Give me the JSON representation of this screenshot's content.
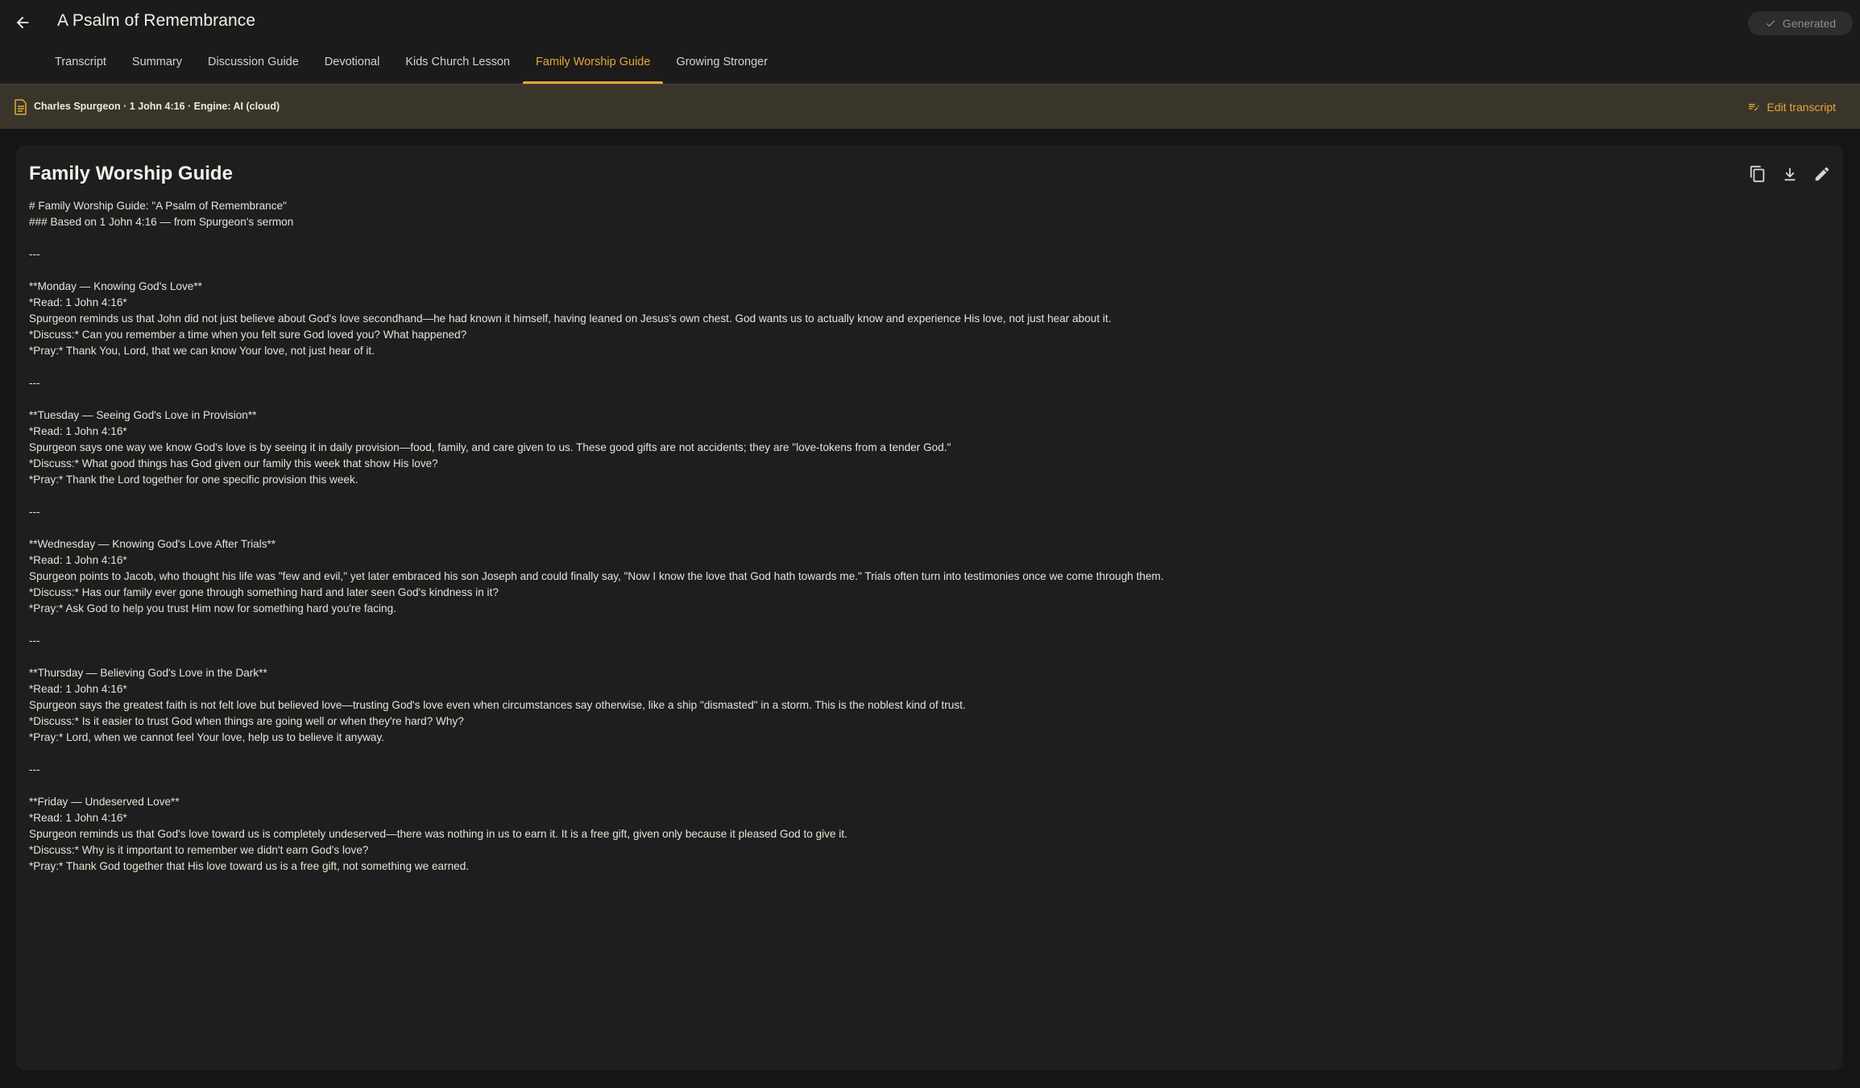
{
  "header": {
    "title": "A Psalm of Remembrance",
    "status_label": "Generated"
  },
  "tabs": [
    {
      "label": "Transcript"
    },
    {
      "label": "Summary"
    },
    {
      "label": "Discussion Guide"
    },
    {
      "label": "Devotional"
    },
    {
      "label": "Kids Church Lesson"
    },
    {
      "label": "Family Worship Guide",
      "active": true
    },
    {
      "label": "Growing Stronger"
    }
  ],
  "infobar": {
    "meta": "Charles Spurgeon · 1 John 4:16 · Engine: AI (cloud)",
    "edit_label": "Edit transcript"
  },
  "card": {
    "title": "Family Worship Guide",
    "lines": [
      "# Family Worship Guide: \"A Psalm of Remembrance\"",
      "### Based on 1 John 4:16 — from Spurgeon's sermon",
      "",
      "---",
      "",
      "**Monday — Knowing God's Love**",
      "*Read: 1 John 4:16*",
      "Spurgeon reminds us that John did not just believe about God's love secondhand—he had known it himself, having leaned on Jesus's own chest. God wants us to actually know and experience His love, not just hear about it.",
      "*Discuss:* Can you remember a time when you felt sure God loved you? What happened?",
      "*Pray:* Thank You, Lord, that we can know Your love, not just hear of it.",
      "",
      "---",
      "",
      "**Tuesday — Seeing God's Love in Provision**",
      "*Read: 1 John 4:16*",
      "Spurgeon says one way we know God's love is by seeing it in daily provision—food, family, and care given to us. These good gifts are not accidents; they are \"love-tokens from a tender God.\"",
      "*Discuss:* What good things has God given our family this week that show His love?",
      "*Pray:* Thank the Lord together for one specific provision this week.",
      "",
      "---",
      "",
      "**Wednesday — Knowing God's Love After Trials**",
      "*Read: 1 John 4:16*",
      "Spurgeon points to Jacob, who thought his life was \"few and evil,\" yet later embraced his son Joseph and could finally say, \"Now I know the love that God hath towards me.\" Trials often turn into testimonies once we come through them.",
      "*Discuss:* Has our family ever gone through something hard and later seen God's kindness in it?",
      "*Pray:* Ask God to help you trust Him now for something hard you're facing.",
      "",
      "---",
      "",
      "**Thursday — Believing God's Love in the Dark**",
      "*Read: 1 John 4:16*",
      "Spurgeon says the greatest faith is not felt love but believed love—trusting God's love even when circumstances say otherwise, like a ship \"dismasted\" in a storm. This is the noblest kind of trust.",
      "*Discuss:* Is it easier to trust God when things are going well or when they're hard? Why?",
      "*Pray:* Lord, when we cannot feel Your love, help us to believe it anyway.",
      "",
      "---",
      "",
      "**Friday — Undeserved Love**",
      "*Read: 1 John 4:16*",
      "Spurgeon reminds us that God's love toward us is completely undeserved—there was nothing in us to earn it. It is a free gift, given only because it pleased God to give it.",
      "*Discuss:* Why is it important to remember we didn't earn God's love?",
      "*Pray:* Thank God together that His love toward us is a free gift, not something we earned."
    ]
  },
  "icons": {
    "back": "arrow-back-icon",
    "status": "check-icon",
    "document": "document-icon",
    "edit_transcript": "edit-note-icon",
    "copy": "copy-icon",
    "download": "download-icon",
    "edit": "pencil-icon"
  },
  "colors": {
    "accent": "#e6a736",
    "background": "#151515",
    "infobar": "#3a352b",
    "card": "#1e1e1e"
  }
}
